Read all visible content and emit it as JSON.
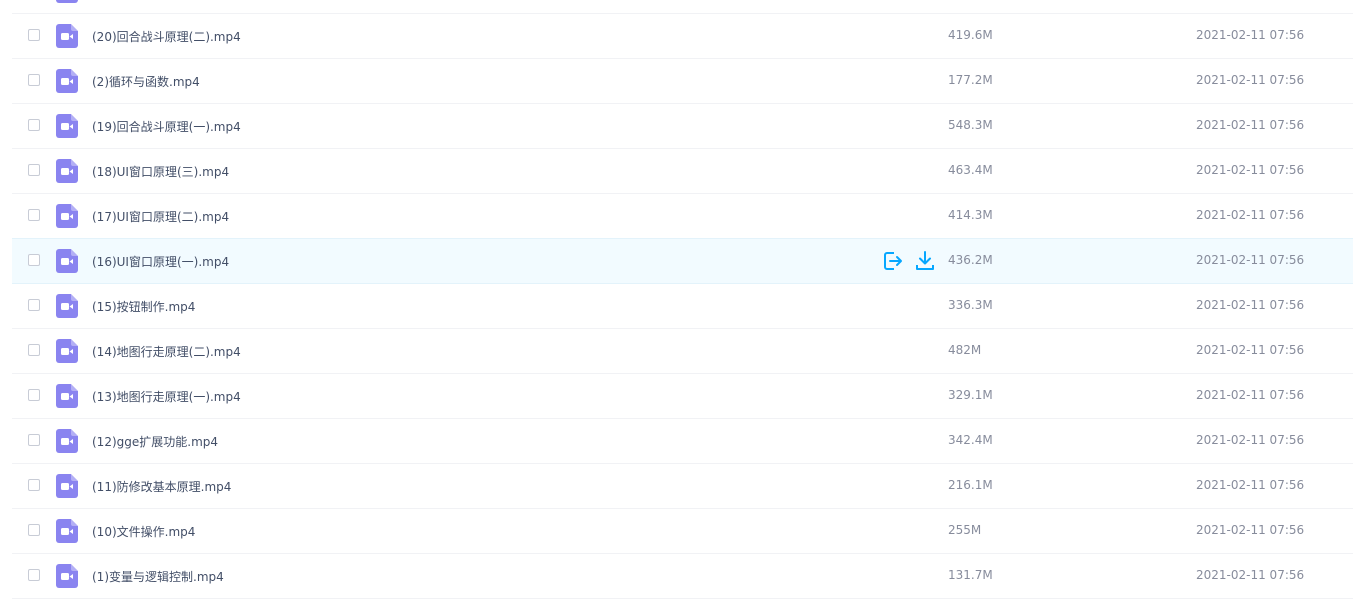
{
  "colors": {
    "video_icon": "#8a84f0",
    "action_blue": "#06a7ff",
    "hover_bg": "#f2fbff"
  },
  "files": [
    {
      "name": "",
      "size": "",
      "time": ""
    },
    {
      "name": "(20)回合战斗原理(二).mp4",
      "size": "419.6M",
      "time": "2021-02-11 07:56"
    },
    {
      "name": "(2)循环与函数.mp4",
      "size": "177.2M",
      "time": "2021-02-11 07:56"
    },
    {
      "name": "(19)回合战斗原理(一).mp4",
      "size": "548.3M",
      "time": "2021-02-11 07:56"
    },
    {
      "name": "(18)UI窗口原理(三).mp4",
      "size": "463.4M",
      "time": "2021-02-11 07:56"
    },
    {
      "name": "(17)UI窗口原理(二).mp4",
      "size": "414.3M",
      "time": "2021-02-11 07:56"
    },
    {
      "name": "(16)UI窗口原理(一).mp4",
      "size": "436.2M",
      "time": "2021-02-11 07:56",
      "hovered": true
    },
    {
      "name": "(15)按钮制作.mp4",
      "size": "336.3M",
      "time": "2021-02-11 07:56"
    },
    {
      "name": "(14)地图行走原理(二).mp4",
      "size": "482M",
      "time": "2021-02-11 07:56"
    },
    {
      "name": "(13)地图行走原理(一).mp4",
      "size": "329.1M",
      "time": "2021-02-11 07:56"
    },
    {
      "name": "(12)gge扩展功能.mp4",
      "size": "342.4M",
      "time": "2021-02-11 07:56"
    },
    {
      "name": "(11)防修改基本原理.mp4",
      "size": "216.1M",
      "time": "2021-02-11 07:56"
    },
    {
      "name": "(10)文件操作.mp4",
      "size": "255M",
      "time": "2021-02-11 07:56"
    },
    {
      "name": "(1)变量与逻辑控制.mp4",
      "size": "131.7M",
      "time": "2021-02-11 07:56"
    }
  ],
  "icons": {
    "file": "video-file-icon",
    "share": "share-icon",
    "download": "download-icon"
  }
}
